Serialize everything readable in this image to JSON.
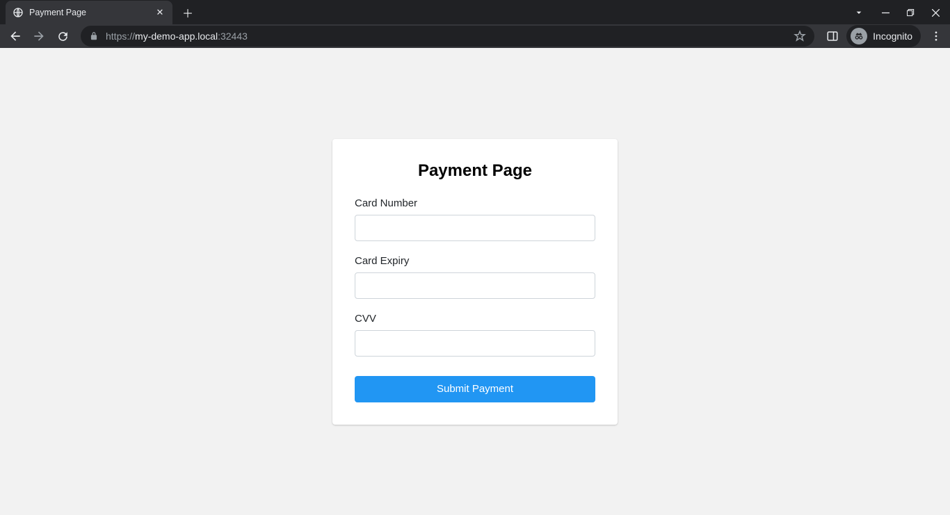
{
  "browser": {
    "tab_title": "Payment Page",
    "url_scheme": "https://",
    "url_host": "my-demo-app.local",
    "url_port": ":32443",
    "incognito_label": "Incognito"
  },
  "page": {
    "title": "Payment Page",
    "fields": {
      "card_number": {
        "label": "Card Number",
        "value": ""
      },
      "card_expiry": {
        "label": "Card Expiry",
        "value": ""
      },
      "cvv": {
        "label": "CVV",
        "value": ""
      }
    },
    "submit_label": "Submit Payment"
  }
}
